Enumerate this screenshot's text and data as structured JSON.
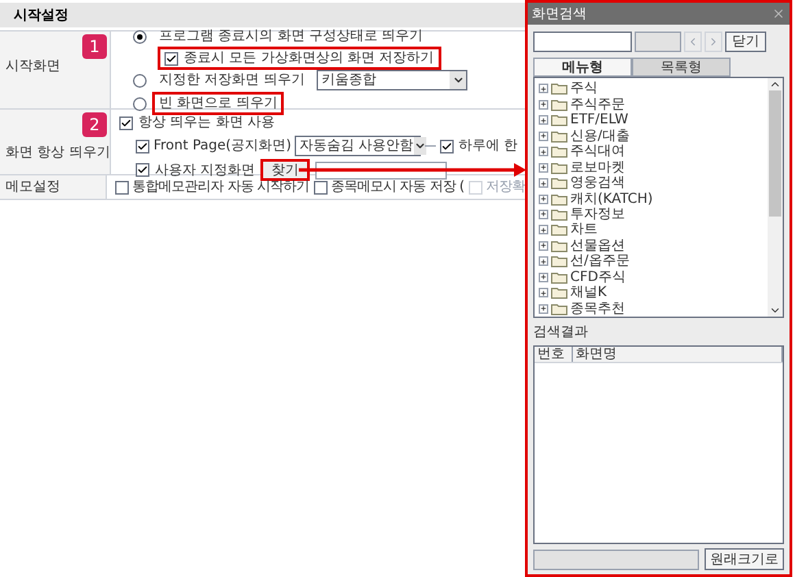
{
  "section_title": "시작설정",
  "start_screen": {
    "label": "시작화면",
    "badge": "1",
    "options": [
      {
        "label": "프로그램 종료시의 화면 구성상태로 띄우기",
        "selected": true,
        "highlighted": false,
        "sub_option": {
          "label": "종료시 모든 가상화면상의 화면 저장하기",
          "checked": true,
          "highlighted": true
        }
      },
      {
        "label": "지정한 저장화면 띄우기",
        "selected": false,
        "highlighted": false,
        "dropdown": "키움종합"
      },
      {
        "label": "빈 화면으로 띄우기",
        "selected": false,
        "highlighted": true
      }
    ]
  },
  "always_screen": {
    "label": "화면 항상 띄우기",
    "badge": "2",
    "main": {
      "label": "항상 띄우는 화면 사용",
      "checked": true
    },
    "front_page": {
      "label": "Front Page(공지화면)",
      "checked": true,
      "dropdown": "자동숨김 사용안함",
      "daily": {
        "label": "하루에 한",
        "checked": true
      }
    },
    "user_screen": {
      "label": "사용자 지정화면",
      "checked": true,
      "button": "찾기",
      "highlighted": true
    }
  },
  "memo": {
    "label": "메모설정",
    "options": [
      {
        "label": "통합메모관리자 자동 시작하기",
        "checked": false,
        "disabled": false
      },
      {
        "label": "종목메모시 자동 저장 (",
        "checked": false,
        "disabled": false
      },
      {
        "label": "저장확",
        "checked": false,
        "disabled": true
      }
    ]
  },
  "dialog": {
    "title": "화면검색",
    "close_button": "닫기",
    "tabs": [
      {
        "label": "메뉴형",
        "selected": true
      },
      {
        "label": "목록형",
        "selected": false
      }
    ],
    "tree": [
      "주식",
      "주식주문",
      "ETF/ELW",
      "신용/대출",
      "주식대여",
      "로보마켓",
      "영웅검색",
      "캐치(KATCH)",
      "투자정보",
      "차트",
      "선물옵션",
      "선/옵주문",
      "CFD주식",
      "채널K",
      "종목추천"
    ],
    "results_label": "검색결과",
    "columns": [
      "번호",
      "화면명"
    ],
    "restore_button": "원래크기로"
  }
}
